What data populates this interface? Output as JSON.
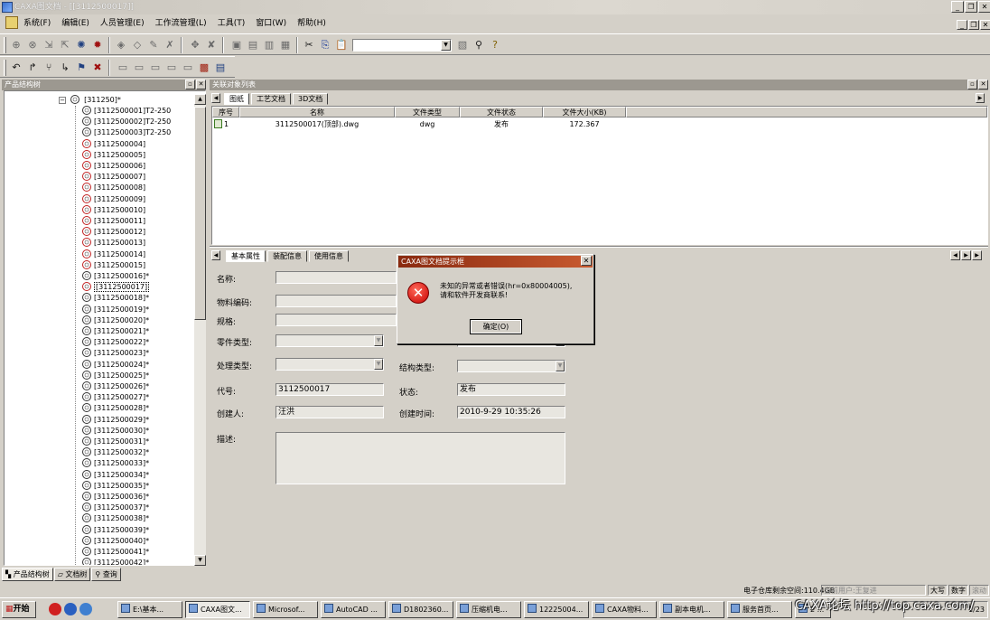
{
  "window": {
    "title": "CAXA图文档 - [[3112500017]]"
  },
  "menu": [
    "系统(F)",
    "编辑(E)",
    "人员管理(E)",
    "工作流管理(L)",
    "工具(T)",
    "窗口(W)",
    "帮助(H)"
  ],
  "toolbar": {
    "icons": [
      "add-icon",
      "delete-icon",
      "checkin-icon",
      "checkout-icon",
      "gear-icon",
      "record-icon",
      "open-icon",
      "browse-icon",
      "edit-icon",
      "cancel-icon",
      "move-icon",
      "undo-icon",
      "import-icon",
      "export-icon",
      "copy-icon",
      "paste-icon",
      "cut-icon",
      "copy2-icon",
      "paste2-icon",
      "search-icon",
      "help-icon"
    ]
  },
  "left_panel": {
    "title": "产品结构树",
    "root": "[311250]*",
    "items": [
      "[3112500001]T2-250",
      "[3112500002]T2-250",
      "[3112500003]T2-250",
      "[3112500004]",
      "[3112500005]",
      "[3112500006]",
      "[3112500007]",
      "[3112500008]",
      "[3112500009]",
      "[3112500010]",
      "[3112500011]",
      "[3112500012]",
      "[3112500013]",
      "[3112500014]",
      "[3112500015]",
      "[3112500016]*",
      "[3112500017]",
      "[3112500018]*",
      "[3112500019]*",
      "[3112500020]*",
      "[3112500021]*",
      "[3112500022]*",
      "[3112500023]*",
      "[3112500024]*",
      "[3112500025]*",
      "[3112500026]*",
      "[3112500027]*",
      "[3112500028]*",
      "[3112500029]*",
      "[3112500030]*",
      "[3112500031]*",
      "[3112500032]*",
      "[3112500033]*",
      "[3112500034]*",
      "[3112500035]*",
      "[3112500036]*",
      "[3112500037]*",
      "[3112500038]*",
      "[3112500039]*",
      "[3112500040]*",
      "[3112500041]*",
      "[3112500042]*"
    ],
    "red_items": [
      3,
      4,
      5,
      6,
      7,
      8,
      9,
      10,
      11,
      12,
      13,
      14,
      16
    ],
    "selected_index": 16,
    "tabs": [
      "产品结构树",
      "文档树",
      "查询"
    ]
  },
  "right_panel": {
    "title": "关联对象列表",
    "tabs": [
      "图纸",
      "工艺文档",
      "3D文档"
    ],
    "columns": [
      "序号",
      "名称",
      "文件类型",
      "文件状态",
      "文件大小(KB)"
    ],
    "rows": [
      {
        "no": "1",
        "name": "3112500017(顶部).dwg",
        "type": "dwg",
        "status": "发布",
        "size": "172.367"
      }
    ],
    "prop_tabs": [
      "基本属性",
      "装配信息",
      "使用信息"
    ]
  },
  "form": {
    "name_label": "名称:",
    "material_label": "物料编码:",
    "spec_label": "规格:",
    "part_type_label": "零件类型:",
    "process_type_label": "处理类型:",
    "struct_type_label": "结构类型:",
    "code_label": "代号:",
    "code_value": "3112500017",
    "state_label": "状态:",
    "state_value": "发布",
    "creator_label": "创建人:",
    "creator_value": "汪洪",
    "created_label": "创建时间:",
    "created_value": "2010-9-29 10:35:26",
    "desc_label": "描述:"
  },
  "dialog": {
    "title": "CAXA图文档提示框",
    "message_line1": "未知的异常或者错误(hr=0x80004005),",
    "message_line2": "请和软件开发商联系!",
    "ok_label": "确定(O)"
  },
  "status": {
    "storage": "电子仓库剩余空间:110.4GB",
    "user": "当前用户:王复进",
    "caps": "大写",
    "num": "数字",
    "scroll": "滚动"
  },
  "taskbar": {
    "start": "开始",
    "tasks": [
      "E:\\基本...",
      "CAXA图文...",
      "Microsof...",
      "AutoCAD ...",
      "D1802360...",
      "压缩机电...",
      "12225004...",
      "CAXA物料...",
      "副本电机...",
      "服务首页...",
      "2 ..."
    ],
    "active_index": 1,
    "clock": "1/23"
  },
  "watermark": "CAXA论坛 http://top.caxa.com/"
}
